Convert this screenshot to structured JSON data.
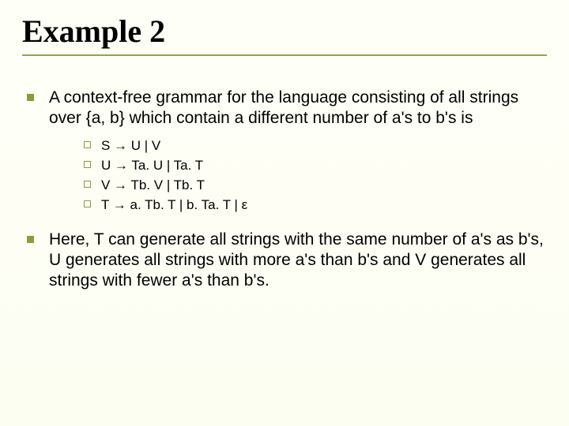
{
  "title": "Example 2",
  "bullets": {
    "intro": "A context-free grammar for the language consisting of all strings over {a, b} which contain a different number of a's to b's is",
    "rules": [
      "S → U | V",
      "U → Ta. U | Ta. T",
      "V → Tb. V | Tb. T",
      "T → a. Tb. T | b. Ta. T | ε"
    ],
    "explanation": "Here, T can generate all strings with the same number of a's as b's, U generates all strings with more a's than b's and V generates all strings with fewer a's than b's."
  }
}
